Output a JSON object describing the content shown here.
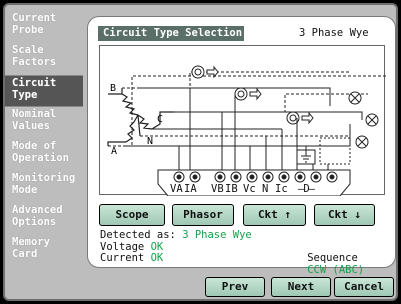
{
  "sidebar": {
    "items": [
      {
        "label": "Current\nProbe"
      },
      {
        "label": "Scale\nFactors"
      },
      {
        "label": "Circuit\nType",
        "active": true
      },
      {
        "label": "Nominal\nValues"
      },
      {
        "label": "Mode of\nOperation"
      },
      {
        "label": "Monitoring\nMode"
      },
      {
        "label": "Advanced\nOptions"
      },
      {
        "label": "Memory\nCard"
      }
    ]
  },
  "panel": {
    "title": "Circuit Type Selection",
    "mode": "3 Phase Wye"
  },
  "diagram": {
    "source_labels": {
      "b": "B",
      "c": "C",
      "a": "A",
      "n": "N"
    },
    "terminal_labels": {
      "va": "VA",
      "ia": "IA",
      "vb": "VB",
      "ib": "IB",
      "vc": "Vc",
      "n": "N",
      "ic": "Ic",
      "d": "D"
    }
  },
  "buttons": {
    "scope": "Scope",
    "phasor": "Phasor",
    "ckt_up": "Ckt ↑",
    "ckt_down": "Ckt ↓"
  },
  "status": {
    "detected_label": "Detected as:",
    "detected_value": "3 Phase Wye",
    "voltage_label": "Voltage",
    "voltage_value": "OK",
    "sequence_label": "Sequence",
    "sequence_value": "CCW (ABC)",
    "current_label": "Current",
    "current_value": "OK"
  },
  "nav": {
    "prev": "Prev",
    "next": "Next",
    "cancel": "Cancel"
  },
  "colors": {
    "ok": "#15a24a",
    "titlebar": "#5a6f67",
    "button": "#b4d8c4"
  }
}
